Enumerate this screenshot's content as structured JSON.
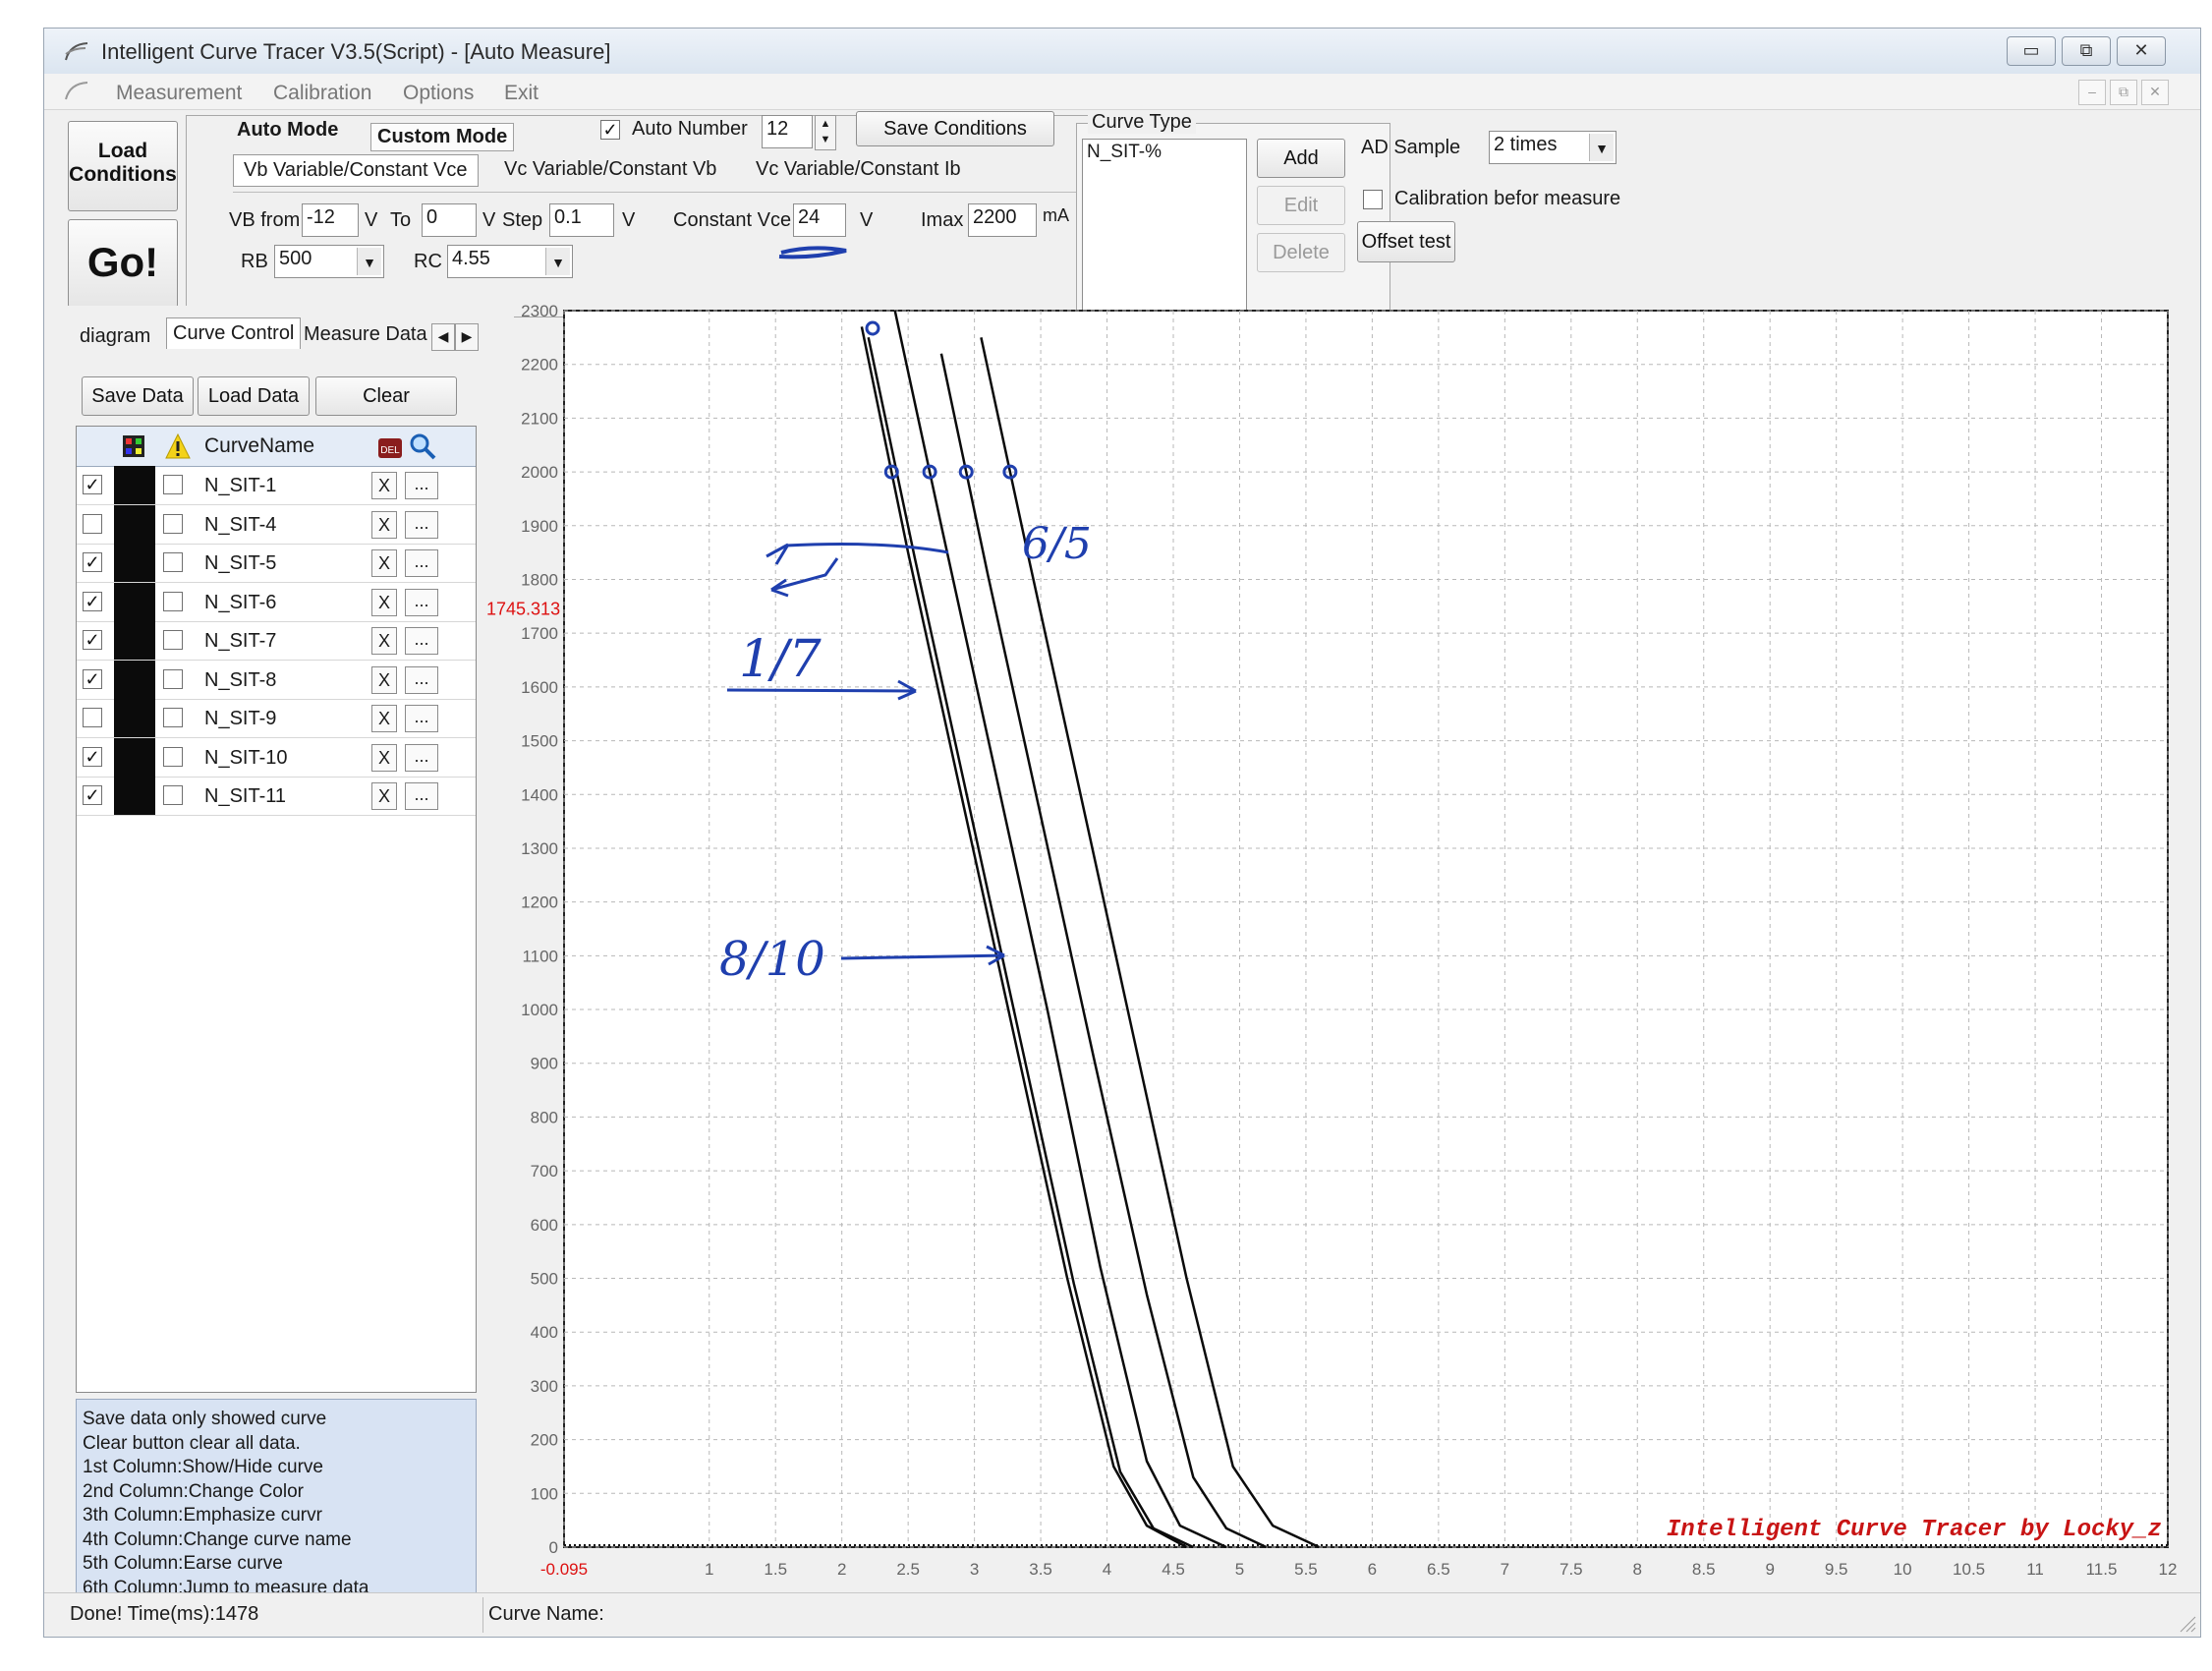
{
  "window": {
    "title": "Intelligent Curve Tracer V3.5(Script) - [Auto Measure]",
    "controls": [
      "▭",
      "⧉",
      "✕"
    ]
  },
  "menu": [
    "Measurement",
    "Calibration",
    "Options",
    "Exit"
  ],
  "toolbar": {
    "load_conditions": "Load Conditions",
    "go": "Go!",
    "auto_mode": "Auto Mode",
    "custom_mode": "Custom Mode",
    "auto_number_label": "Auto Number",
    "auto_number_checked": true,
    "auto_number_value": "12",
    "save_conditions": "Save Conditions",
    "mode_tabs": [
      "Vb Variable/Constant Vce",
      "Vc Variable/Constant Vb",
      "Vc Variable/Constant Ib"
    ],
    "vb_from_label": "VB from",
    "vb_from": "-12",
    "v1": "V",
    "to_label": "To",
    "to": "0",
    "v2": "V",
    "step_label": "Step",
    "step": "0.1",
    "v3": "V",
    "constant_vce_label": "Constant Vce",
    "constant_vce": "24",
    "v4": "V",
    "imax_label": "Imax",
    "imax": "2200",
    "ma": "mA",
    "rb_label": "RB",
    "rb": "500",
    "rc_label": "RC",
    "rc": "4.55"
  },
  "curve_type": {
    "label": "Curve Type",
    "value": "N_SIT-%",
    "add": "Add",
    "edit": "Edit",
    "delete": "Delete"
  },
  "ad_sample": {
    "label": "AD Sample",
    "value": "2 times",
    "calibration_label": "Calibration befor measure",
    "calibration_checked": false,
    "offset_test": "Offset test"
  },
  "left_tabs": [
    "diagram",
    "Curve Control",
    "Measure Data"
  ],
  "left_buttons": {
    "save": "Save Data",
    "load": "Load Data",
    "clear": "Clear"
  },
  "table": {
    "header": "CurveName",
    "rows": [
      {
        "name": "N_SIT-1",
        "shown": true
      },
      {
        "name": "N_SIT-4",
        "shown": false
      },
      {
        "name": "N_SIT-5",
        "shown": true
      },
      {
        "name": "N_SIT-6",
        "shown": true
      },
      {
        "name": "N_SIT-7",
        "shown": true
      },
      {
        "name": "N_SIT-8",
        "shown": true
      },
      {
        "name": "N_SIT-9",
        "shown": false
      },
      {
        "name": "N_SIT-10",
        "shown": true
      },
      {
        "name": "N_SIT-11",
        "shown": true
      }
    ],
    "x_label": "X",
    "dots_label": "..."
  },
  "help": [
    " Save data only showed curve",
    " Clear button clear all data.",
    "1st Column:Show/Hide curve",
    "2nd Column:Change Color",
    "3th Column:Emphasize curvr",
    "4th Column:Change curve name",
    "5th Column:Earse curve",
    "6th Column:Jump to measure data"
  ],
  "status": {
    "left": "Done!  Time(ms):1478",
    "right": "Curve Name:"
  },
  "chart_data": {
    "type": "line",
    "xlim": [
      -0.095,
      12
    ],
    "ylim": [
      0,
      2300
    ],
    "x_ticks": [
      "-0.095",
      "1",
      "1.5",
      "2",
      "2.5",
      "3",
      "3.5",
      "4",
      "4.5",
      "5",
      "5.5",
      "6",
      "6.5",
      "7",
      "7.5",
      "8",
      "8.5",
      "9",
      "9.5",
      "10",
      "10.5",
      "11",
      "11.5",
      "12"
    ],
    "y_ticks": [
      0,
      100,
      200,
      300,
      400,
      500,
      600,
      700,
      800,
      900,
      1000,
      1100,
      1200,
      1300,
      1400,
      1500,
      1600,
      1700,
      1800,
      1900,
      2000,
      2100,
      2200,
      2300
    ],
    "cursor_label": "1745.313",
    "watermark": "Intelligent Curve Tracer by Locky_z",
    "grid": true,
    "series": [
      {
        "x": [
          2.15,
          2.5,
          2.9,
          3.3,
          3.7,
          4.05,
          4.3,
          4.6
        ],
        "y": [
          2270,
          1850,
          1400,
          950,
          500,
          150,
          40,
          0
        ]
      },
      {
        "x": [
          2.2,
          2.55,
          2.95,
          3.35,
          3.75,
          4.1,
          4.35,
          4.65
        ],
        "y": [
          2250,
          1840,
          1390,
          940,
          490,
          140,
          35,
          0
        ]
      },
      {
        "x": [
          2.4,
          2.75,
          3.15,
          3.55,
          3.95,
          4.3,
          4.55,
          4.9
        ],
        "y": [
          2300,
          1900,
          1450,
          1000,
          520,
          160,
          40,
          0
        ]
      },
      {
        "x": [
          2.75,
          3.1,
          3.5,
          3.9,
          4.3,
          4.65,
          4.9,
          5.2
        ],
        "y": [
          2220,
          1810,
          1360,
          910,
          470,
          130,
          35,
          0
        ]
      },
      {
        "x": [
          3.05,
          3.4,
          3.8,
          4.2,
          4.6,
          4.95,
          5.25,
          5.6
        ],
        "y": [
          2250,
          1850,
          1400,
          950,
          500,
          150,
          40,
          0
        ]
      }
    ]
  },
  "annotations": {
    "a1": "6/5",
    "a2": "1/7",
    "a3": "8/10"
  }
}
